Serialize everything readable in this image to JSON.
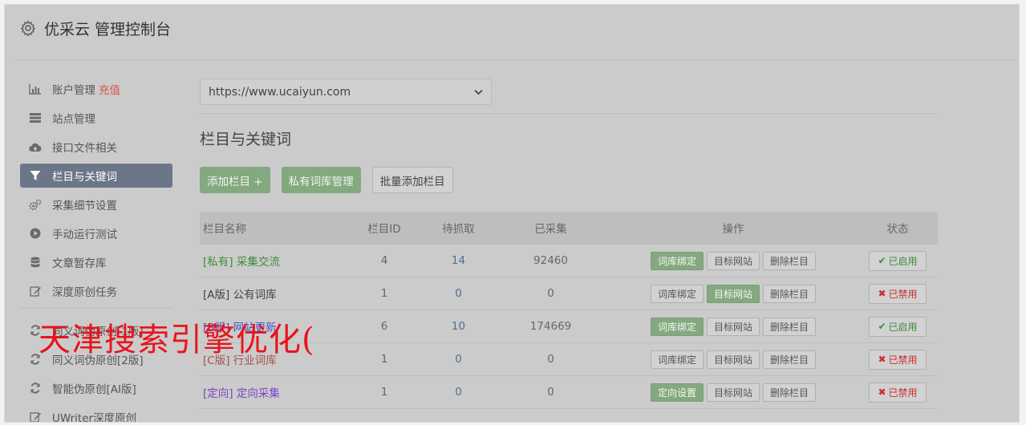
{
  "header": {
    "title": "优采云 管理控制台",
    "icon": "gear-icon"
  },
  "sidebar": {
    "items": [
      {
        "label": "账户管理",
        "extra": "充值",
        "icon": "bar-chart-icon"
      },
      {
        "label": "站点管理",
        "icon": "server-icon"
      },
      {
        "label": "接口文件相关",
        "icon": "cloud-upload-icon"
      },
      {
        "label": "栏目与关键词",
        "icon": "filter-icon",
        "active": true
      },
      {
        "label": "采集细节设置",
        "icon": "cogs-icon"
      },
      {
        "label": "手动运行测试",
        "icon": "play-circle-icon"
      },
      {
        "label": "文章暂存库",
        "icon": "database-icon"
      },
      {
        "label": "深度原创任务",
        "icon": "edit-icon"
      },
      {
        "label": "同义词伪原创[1版]",
        "icon": "refresh-icon"
      },
      {
        "label": "同义词伪原创[2版]",
        "icon": "refresh-icon"
      },
      {
        "label": "智能伪原创[AI版]",
        "icon": "refresh-icon"
      },
      {
        "label": "UWriter深度原创",
        "icon": "edit-icon"
      }
    ]
  },
  "main": {
    "site_select": {
      "value": "https://www.ucaiyun.com"
    },
    "section_title": "栏目与关键词",
    "buttons": {
      "add_column": "添加栏目 +",
      "private_lexicon": "私有词库管理",
      "batch_add": "批量添加栏目"
    },
    "table": {
      "headers": [
        "栏目名称",
        "栏目ID",
        "待抓取",
        "已采集",
        "操作",
        "状态"
      ],
      "rows": [
        {
          "tag": "[私有]",
          "name": "采集交流",
          "id": "4",
          "pending": "14",
          "collected": "92460",
          "op1": "词库绑定",
          "op2": "目标网站",
          "op3": "删除栏目",
          "status": "已启用",
          "active_op": "op1",
          "enabled": true,
          "tag_color": "#3f8a3a"
        },
        {
          "tag": "[A版]",
          "name": "公有词库",
          "id": "1",
          "pending": "0",
          "collected": "0",
          "op1": "词库绑定",
          "op2": "目标网站",
          "op3": "删除栏目",
          "status": "已禁用",
          "active_op": "op2",
          "enabled": false,
          "tag_color": "#444444"
        },
        {
          "tag": "[B版]",
          "name": "网站更新",
          "id": "6",
          "pending": "10",
          "collected": "174669",
          "op1": "词库绑定",
          "op2": "目标网站",
          "op3": "删除栏目",
          "status": "已启用",
          "active_op": "op1",
          "enabled": true,
          "tag_color": "#4a57c4"
        },
        {
          "tag": "[C版]",
          "name": "行业词库",
          "id": "1",
          "pending": "0",
          "collected": "0",
          "op1": "词库绑定",
          "op2": "目标网站",
          "op3": "删除栏目",
          "status": "已禁用",
          "active_op": "none",
          "enabled": false,
          "tag_color": "#a45050"
        },
        {
          "tag": "[定向]",
          "name": "定向采集",
          "id": "1",
          "pending": "0",
          "collected": "0",
          "op1": "定向设置",
          "op2": "目标网站",
          "op3": "删除栏目",
          "status": "已禁用",
          "active_op": "op1",
          "enabled": false,
          "tag_color": "#7a44c9"
        }
      ]
    }
  },
  "watermark": "天津搜索引擎优化("
}
